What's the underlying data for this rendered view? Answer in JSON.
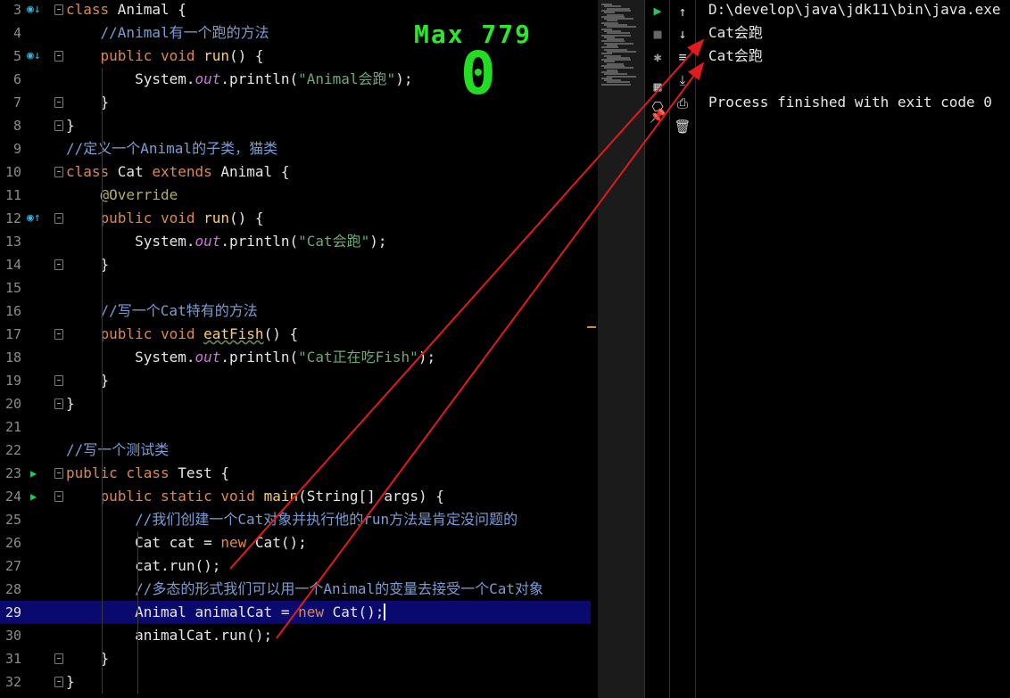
{
  "editor": {
    "lines": [
      {
        "n": "3",
        "segs": [
          {
            "t": "class ",
            "c": "kw"
          },
          {
            "t": "Animal {"
          }
        ]
      },
      {
        "n": "4",
        "segs": [
          {
            "t": "    "
          },
          {
            "t": "//Animal有一个跑的方法",
            "c": "cmt"
          }
        ]
      },
      {
        "n": "5",
        "segs": [
          {
            "t": "    "
          },
          {
            "t": "public void ",
            "c": "kw"
          },
          {
            "t": "run",
            "c": "fn"
          },
          {
            "t": "() {"
          }
        ]
      },
      {
        "n": "6",
        "segs": [
          {
            "t": "        System."
          },
          {
            "t": "out",
            "c": "field"
          },
          {
            "t": ".println("
          },
          {
            "t": "\"Animal会跑\"",
            "c": "str"
          },
          {
            "t": ");"
          }
        ]
      },
      {
        "n": "7",
        "segs": [
          {
            "t": "    }"
          }
        ]
      },
      {
        "n": "8",
        "segs": [
          {
            "t": "}"
          }
        ]
      },
      {
        "n": "9",
        "segs": [
          {
            "t": "//定义一个Animal的子类，猫类",
            "c": "cmt"
          }
        ]
      },
      {
        "n": "10",
        "segs": [
          {
            "t": "class ",
            "c": "kw"
          },
          {
            "t": "Cat "
          },
          {
            "t": "extends ",
            "c": "kw"
          },
          {
            "t": "Animal {"
          }
        ]
      },
      {
        "n": "11",
        "segs": [
          {
            "t": "    "
          },
          {
            "t": "@Override",
            "c": "ann"
          }
        ]
      },
      {
        "n": "12",
        "segs": [
          {
            "t": "    "
          },
          {
            "t": "public void ",
            "c": "kw"
          },
          {
            "t": "run",
            "c": "fn"
          },
          {
            "t": "() {"
          }
        ]
      },
      {
        "n": "13",
        "segs": [
          {
            "t": "        System."
          },
          {
            "t": "out",
            "c": "field"
          },
          {
            "t": ".println("
          },
          {
            "t": "\"Cat会跑\"",
            "c": "str"
          },
          {
            "t": ");"
          }
        ]
      },
      {
        "n": "14",
        "segs": [
          {
            "t": "    }"
          }
        ]
      },
      {
        "n": "15",
        "segs": []
      },
      {
        "n": "16",
        "segs": [
          {
            "t": "    "
          },
          {
            "t": "//写一个Cat特有的方法",
            "c": "cmt"
          }
        ]
      },
      {
        "n": "17",
        "segs": [
          {
            "t": "    "
          },
          {
            "t": "public void ",
            "c": "kw"
          },
          {
            "t": "eatFish",
            "c": "fn typo"
          },
          {
            "t": "() {"
          }
        ]
      },
      {
        "n": "18",
        "segs": [
          {
            "t": "        System."
          },
          {
            "t": "out",
            "c": "field"
          },
          {
            "t": ".println("
          },
          {
            "t": "\"Cat正在吃Fish\"",
            "c": "str"
          },
          {
            "t": ");"
          }
        ]
      },
      {
        "n": "19",
        "segs": [
          {
            "t": "    }"
          }
        ]
      },
      {
        "n": "20",
        "segs": [
          {
            "t": "}"
          }
        ]
      },
      {
        "n": "21",
        "segs": []
      },
      {
        "n": "22",
        "segs": [
          {
            "t": "//写一个测试类",
            "c": "cmt"
          }
        ]
      },
      {
        "n": "23",
        "segs": [
          {
            "t": "public class ",
            "c": "kw"
          },
          {
            "t": "Test {"
          }
        ]
      },
      {
        "n": "24",
        "segs": [
          {
            "t": "    "
          },
          {
            "t": "public static void ",
            "c": "kw"
          },
          {
            "t": "main",
            "c": "fn"
          },
          {
            "t": "(String[] args) {"
          }
        ]
      },
      {
        "n": "25",
        "segs": [
          {
            "t": "        "
          },
          {
            "t": "//我们创建一个Cat对象并执行他的run方法是肯定没问题的",
            "c": "cmt"
          }
        ]
      },
      {
        "n": "26",
        "segs": [
          {
            "t": "        Cat cat = "
          },
          {
            "t": "new ",
            "c": "kw"
          },
          {
            "t": "Cat();"
          }
        ]
      },
      {
        "n": "27",
        "segs": [
          {
            "t": "        cat.run();"
          }
        ]
      },
      {
        "n": "28",
        "segs": [
          {
            "t": "        "
          },
          {
            "t": "//多态的形式我们可以用一个Animal的变量去接受一个Cat对象",
            "c": "cmt"
          }
        ]
      },
      {
        "n": "29",
        "segs": [
          {
            "t": "        Animal animalCat = "
          },
          {
            "t": "new ",
            "c": "kw"
          },
          {
            "t": "Cat();",
            "c": "caret"
          }
        ]
      },
      {
        "n": "30",
        "segs": [
          {
            "t": "        animalCat.run();"
          }
        ]
      },
      {
        "n": "31",
        "segs": [
          {
            "t": "    }"
          }
        ]
      },
      {
        "n": "32",
        "segs": [
          {
            "t": "}"
          }
        ]
      }
    ]
  },
  "overlay": {
    "max_label": "Max 779",
    "score": "0",
    "color": "#22dd22"
  },
  "console": {
    "lines": [
      "D:\\develop\\java\\jdk11\\bin\\java.exe",
      "Cat会跑",
      "Cat会跑",
      "",
      "Process finished with exit code 0"
    ]
  },
  "toolbar_a": [
    {
      "name": "rerun-icon",
      "glyph": "▶",
      "color": "#22c55e"
    },
    {
      "name": "stop-icon",
      "glyph": "■",
      "color": "#666666"
    },
    {
      "name": "debug-icon",
      "glyph": "✱",
      "color": "#999999"
    },
    {
      "name": "layout-icon",
      "glyph": "▦",
      "color": "#cccccc"
    },
    {
      "name": "settings-icon",
      "glyph": "⎔",
      "color": "#cccccc"
    },
    {
      "name": "pin-icon",
      "glyph": "📌",
      "color": "#cccccc"
    }
  ],
  "toolbar_b": [
    {
      "name": "arrow-up-icon",
      "glyph": "↑",
      "color": "#dddddd"
    },
    {
      "name": "arrow-down-icon",
      "glyph": "↓",
      "color": "#dddddd"
    },
    {
      "name": "soft-wrap-icon",
      "glyph": "≡",
      "color": "#dddddd"
    },
    {
      "name": "scroll-to-end-icon",
      "glyph": "⤓",
      "color": "#dddddd"
    },
    {
      "name": "print-icon",
      "glyph": "⎙",
      "color": "#dddddd"
    },
    {
      "name": "trash-icon",
      "glyph": "🗑",
      "color": "#dddddd"
    }
  ],
  "colors": {
    "keyword": "#e0874b",
    "function": "#ffd15c",
    "string": "#6aab73",
    "comment": "#7a9dd6",
    "annotation_arrow": "#e01b1b"
  }
}
